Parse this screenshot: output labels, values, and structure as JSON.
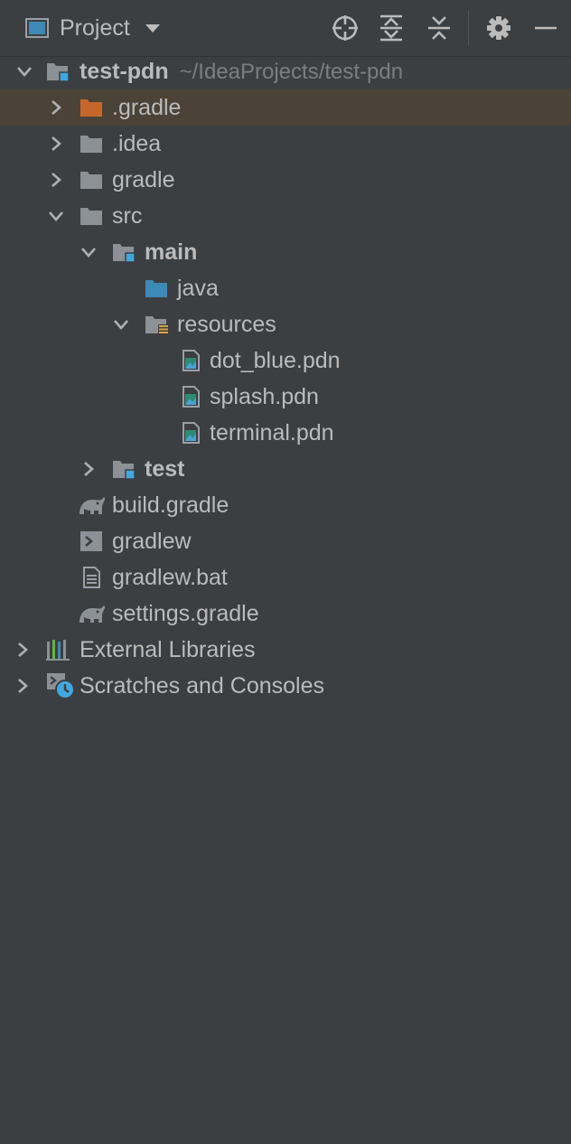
{
  "toolbar": {
    "title": "Project",
    "icons": [
      "window-icon",
      "caret-down-icon",
      "locate-crosshair-icon",
      "expand-all-icon",
      "collapse-all-icon",
      "gear-icon",
      "minimize-icon"
    ]
  },
  "tree": {
    "root": {
      "name": "test-pdn",
      "path": "~/IdeaProjects/test-pdn"
    },
    "items": [
      {
        "name": ".gradle"
      },
      {
        "name": ".idea"
      },
      {
        "name": "gradle"
      },
      {
        "name": "src"
      },
      {
        "name": "main"
      },
      {
        "name": "java"
      },
      {
        "name": "resources"
      },
      {
        "name": "dot_blue.pdn"
      },
      {
        "name": "splash.pdn"
      },
      {
        "name": "terminal.pdn"
      },
      {
        "name": "test"
      },
      {
        "name": "build.gradle"
      },
      {
        "name": "gradlew"
      },
      {
        "name": "gradlew.bat"
      },
      {
        "name": "settings.gradle"
      },
      {
        "name": "External Libraries"
      },
      {
        "name": "Scratches and Consoles"
      }
    ]
  },
  "colors": {
    "background": "#3c3f41",
    "selected_row": "#4b4338",
    "text": "#bbbbbb",
    "path_text": "#7d7d7d",
    "folder_gray": "#8c9196",
    "folder_excluded": "#c5672c",
    "source_folder_blue": "#3d8ab6",
    "module_badge": "#3fa8e3",
    "resources_badge": "#d8a43f"
  }
}
